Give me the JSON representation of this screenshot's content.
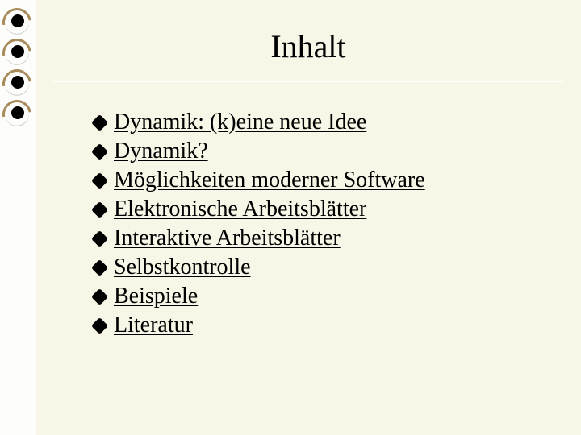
{
  "title": "Inhalt",
  "bullet_glyph_name": "diamond-bullet",
  "items": [
    {
      "label": "Dynamik: (k)eine neue Idee"
    },
    {
      "label": "Dynamik?"
    },
    {
      "label": "Möglichkeiten moderner Software"
    },
    {
      "label": "Elektronische Arbeitsblätter"
    },
    {
      "label": "Interaktive Arbeitsblätter"
    },
    {
      "label": "Selbstkontrolle"
    },
    {
      "label": "Beispiele"
    },
    {
      "label": "Literatur"
    }
  ]
}
